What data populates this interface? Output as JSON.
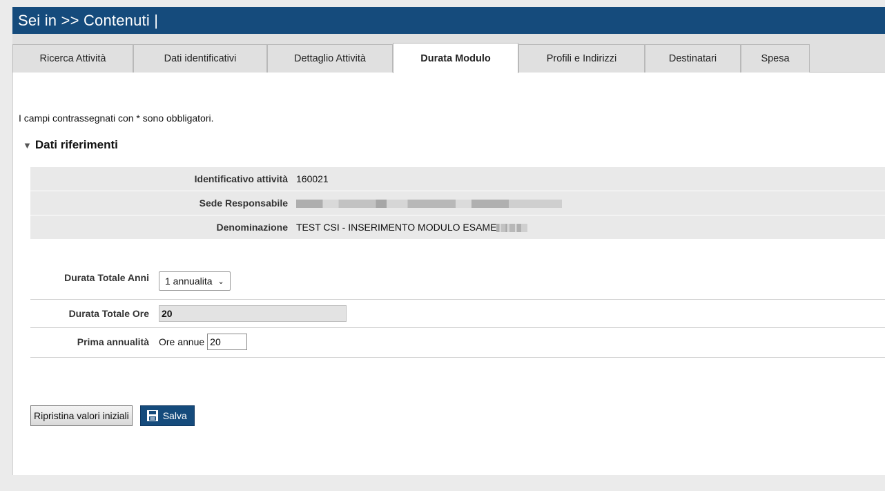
{
  "header": {
    "title": "Sei in >> Contenuti |"
  },
  "tabs": [
    {
      "label": "Ricerca Attività"
    },
    {
      "label": "Dati identificativi"
    },
    {
      "label": "Dettaglio Attività"
    },
    {
      "label": "Durata Modulo"
    },
    {
      "label": "Profili e Indirizzi"
    },
    {
      "label": "Destinatari"
    },
    {
      "label": "Spesa"
    }
  ],
  "active_tab": "Durata Modulo",
  "note": "I campi contrassegnati con * sono obbligatori.",
  "section": {
    "title": "Dati riferimenti",
    "toggle_icon": "triangle-down-icon"
  },
  "references": {
    "id_label": "Identificativo attività",
    "id_value": "160021",
    "sede_label": "Sede Responsabile",
    "den_label": "Denominazione",
    "den_value": "TEST CSI - INSERIMENTO MODULO ESAME"
  },
  "form": {
    "anni_label": "Durata Totale Anni",
    "anni_value": "1 annualita",
    "ore_label": "Durata Totale Ore",
    "ore_value": "20",
    "prima_label": "Prima annualità",
    "ore_annue_label": "Ore annue",
    "ore_annue_value": "20"
  },
  "buttons": {
    "reset": "Ripristina valori iniziali",
    "save": "Salva",
    "save_icon": "floppy-disk-icon"
  },
  "colors": {
    "header_bg": "#154b7c",
    "save_bg": "#154b7c"
  }
}
